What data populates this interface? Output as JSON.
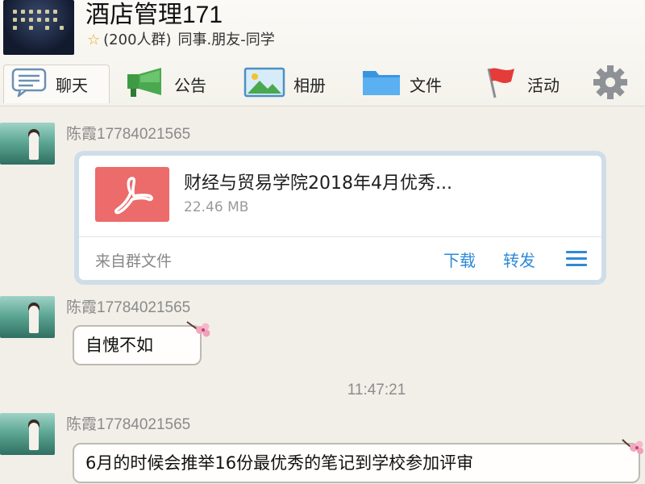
{
  "group": {
    "title": "酒店管理171",
    "member_count": "(200人群)",
    "tag_a": "同事.朋友",
    "tag_sep": "-",
    "tag_b": "同学"
  },
  "toolbar": {
    "chat": "聊天",
    "notice": "公告",
    "album": "相册",
    "files": "文件",
    "activity": "活动"
  },
  "messages": [
    {
      "sender": "陈霞17784021565",
      "file": {
        "name": "财经与贸易学院2018年4月优秀...",
        "size": "22.46 MB",
        "source": "来自群文件",
        "download": "下载",
        "forward": "转发"
      }
    },
    {
      "sender": "陈霞17784021565",
      "text": "自愧不如"
    },
    {
      "sender": "陈霞17784021565",
      "text": "6月的时候会推举16份最优秀的笔记到学校参加评审"
    }
  ],
  "timestamp": "11:47:21",
  "colors": {
    "accent_blue": "#2d8ad8",
    "pdf_red": "#ec6b6b",
    "star": "#e6a91d"
  }
}
